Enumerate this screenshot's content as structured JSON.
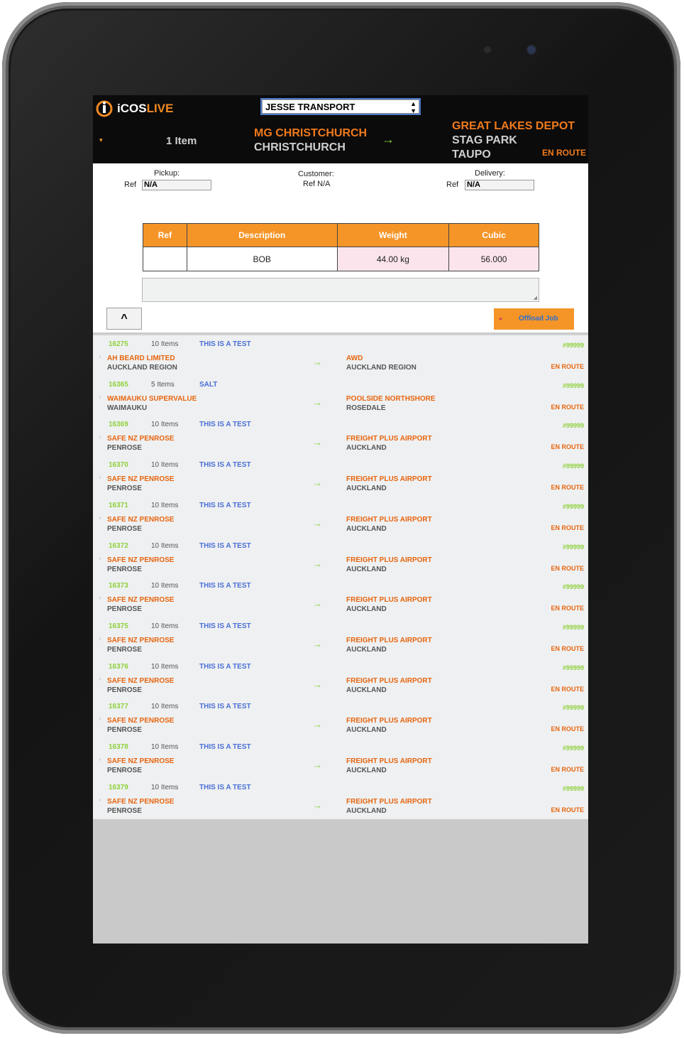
{
  "app": {
    "logo_i": "i",
    "logo_cos": "COS",
    "logo_live": "LIVE",
    "company": "JESSE TRANSPORT"
  },
  "header": {
    "items_count": "1 Item",
    "origin_name": "MG CHRISTCHURCH",
    "origin_city": "CHRISTCHURCH",
    "arrow": "→",
    "dest_name": "GREAT LAKES DEPOT",
    "dest_line2": "STAG PARK",
    "dest_line3": "TAUPO",
    "status": "EN ROUTE"
  },
  "detail": {
    "pickup_label": "Pickup:",
    "pickup_ref_label": "Ref",
    "pickup_ref_value": "N/A",
    "customer_label": "Customer:",
    "customer_ref": "Ref N/A",
    "delivery_label": "Delivery:",
    "delivery_ref_label": "Ref",
    "delivery_ref_value": "N/A"
  },
  "items_table": {
    "columns": [
      "Ref",
      "Description",
      "Weight",
      "Cubic"
    ],
    "rows": [
      {
        "ref": "",
        "description": "BOB",
        "weight": "44.00 kg",
        "cubic": "56.000"
      }
    ]
  },
  "buttons": {
    "up": "^",
    "offload": "Offload Job"
  },
  "jobs": [
    {
      "id": "16275",
      "items": "10 Items",
      "note": "THIS IS A TEST",
      "origin": "AH BEARD LIMITED",
      "origin_city": "AUCKLAND REGION",
      "arrow": "→",
      "dest": "AWD",
      "dest_city": "AUCKLAND REGION",
      "ref": "#99999",
      "status": "EN ROUTE"
    },
    {
      "id": "16365",
      "items": "5 Items",
      "note": "SALT",
      "origin": "WAIMAUKU SUPERVALUE",
      "origin_city": "WAIMAUKU",
      "arrow": "→",
      "dest": "POOLSIDE NORTHSHORE",
      "dest_city": "ROSEDALE",
      "ref": "#99999",
      "status": "EN ROUTE"
    },
    {
      "id": "16369",
      "items": "10 Items",
      "note": "THIS IS A TEST",
      "origin": "SAFE NZ PENROSE",
      "origin_city": "PENROSE",
      "arrow": "→",
      "dest": "FREIGHT PLUS AIRPORT",
      "dest_city": "AUCKLAND",
      "ref": "#99999",
      "status": "EN ROUTE"
    },
    {
      "id": "16370",
      "items": "10 Items",
      "note": "THIS IS A TEST",
      "origin": "SAFE NZ PENROSE",
      "origin_city": "PENROSE",
      "arrow": "→",
      "dest": "FREIGHT PLUS AIRPORT",
      "dest_city": "AUCKLAND",
      "ref": "#99999",
      "status": "EN ROUTE"
    },
    {
      "id": "16371",
      "items": "10 Items",
      "note": "THIS IS A TEST",
      "origin": "SAFE NZ PENROSE",
      "origin_city": "PENROSE",
      "arrow": "→",
      "dest": "FREIGHT PLUS AIRPORT",
      "dest_city": "AUCKLAND",
      "ref": "#99999",
      "status": "EN ROUTE"
    },
    {
      "id": "16372",
      "items": "10 Items",
      "note": "THIS IS A TEST",
      "origin": "SAFE NZ PENROSE",
      "origin_city": "PENROSE",
      "arrow": "→",
      "dest": "FREIGHT PLUS AIRPORT",
      "dest_city": "AUCKLAND",
      "ref": "#99999",
      "status": "EN ROUTE"
    },
    {
      "id": "16373",
      "items": "10 Items",
      "note": "THIS IS A TEST",
      "origin": "SAFE NZ PENROSE",
      "origin_city": "PENROSE",
      "arrow": "→",
      "dest": "FREIGHT PLUS AIRPORT",
      "dest_city": "AUCKLAND",
      "ref": "#99999",
      "status": "EN ROUTE"
    },
    {
      "id": "16375",
      "items": "10 Items",
      "note": "THIS IS A TEST",
      "origin": "SAFE NZ PENROSE",
      "origin_city": "PENROSE",
      "arrow": "→",
      "dest": "FREIGHT PLUS AIRPORT",
      "dest_city": "AUCKLAND",
      "ref": "#99999",
      "status": "EN ROUTE"
    },
    {
      "id": "16376",
      "items": "10 Items",
      "note": "THIS IS A TEST",
      "origin": "SAFE NZ PENROSE",
      "origin_city": "PENROSE",
      "arrow": "→",
      "dest": "FREIGHT PLUS AIRPORT",
      "dest_city": "AUCKLAND",
      "ref": "#99999",
      "status": "EN ROUTE"
    },
    {
      "id": "16377",
      "items": "10 Items",
      "note": "THIS IS A TEST",
      "origin": "SAFE NZ PENROSE",
      "origin_city": "PENROSE",
      "arrow": "→",
      "dest": "FREIGHT PLUS AIRPORT",
      "dest_city": "AUCKLAND",
      "ref": "#99999",
      "status": "EN ROUTE"
    },
    {
      "id": "16378",
      "items": "10 Items",
      "note": "THIS IS A TEST",
      "origin": "SAFE NZ PENROSE",
      "origin_city": "PENROSE",
      "arrow": "→",
      "dest": "FREIGHT PLUS AIRPORT",
      "dest_city": "AUCKLAND",
      "ref": "#99999",
      "status": "EN ROUTE"
    },
    {
      "id": "16379",
      "items": "10 Items",
      "note": "THIS IS A TEST",
      "origin": "SAFE NZ PENROSE",
      "origin_city": "PENROSE",
      "arrow": "→",
      "dest": "FREIGHT PLUS AIRPORT",
      "dest_city": "AUCKLAND",
      "ref": "#99999",
      "status": "EN ROUTE"
    }
  ],
  "colors": {
    "accent_orange": "#f59528",
    "green": "#8fd13b",
    "blue_text": "#4a6fd6",
    "header_bg": "#0b0b0b"
  },
  "icons": {
    "logo": "icoslive-logo-icon",
    "select": "select-arrows-icon",
    "expand": "caret-icon"
  }
}
